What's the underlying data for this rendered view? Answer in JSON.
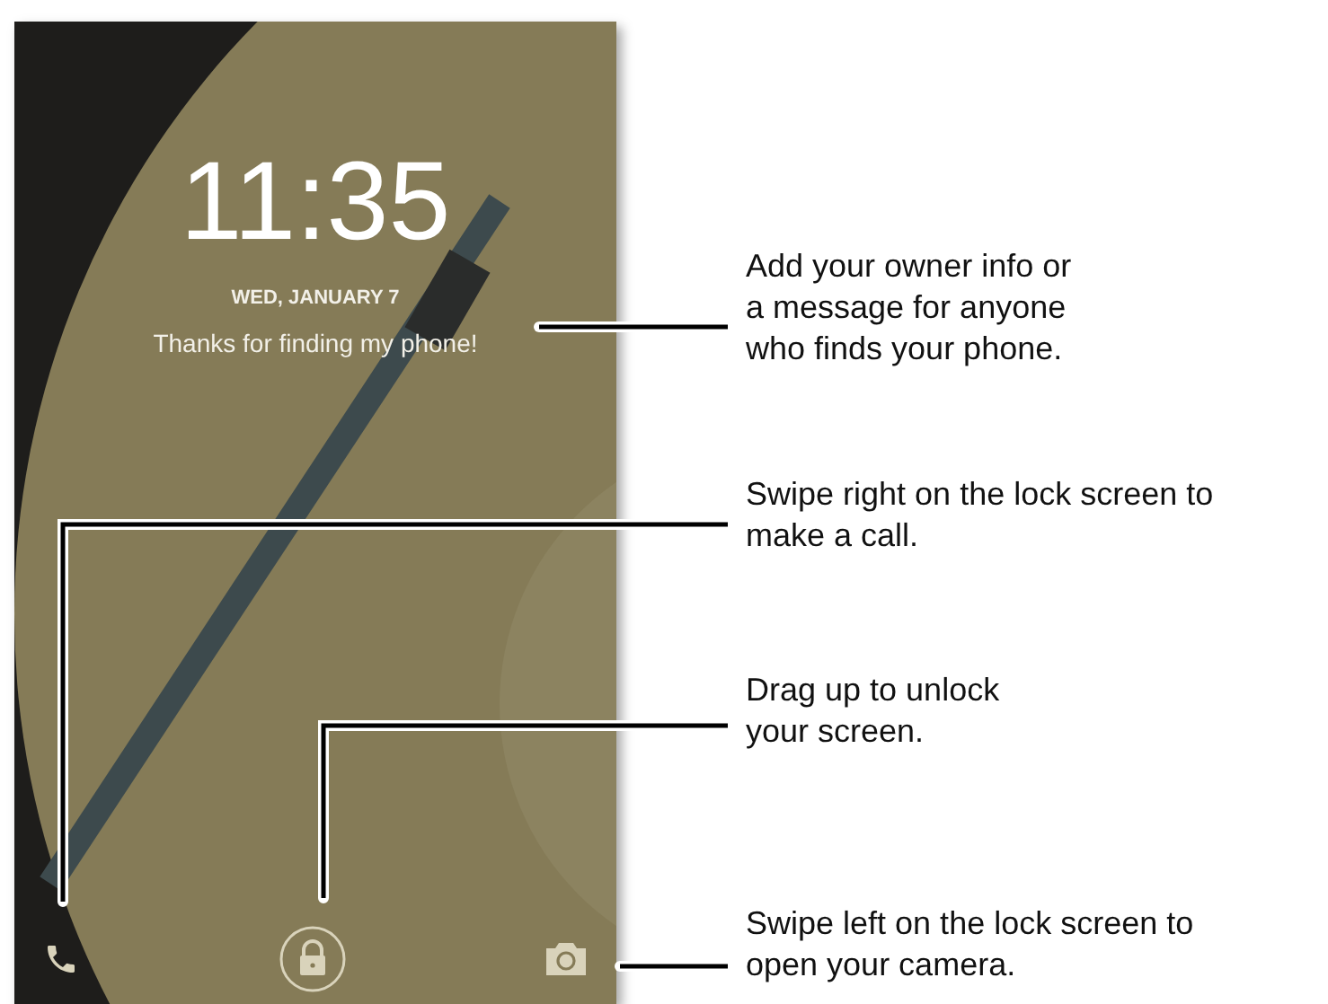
{
  "lock_screen": {
    "time": "11:35",
    "date": "WED, JANUARY 7",
    "owner_message": "Thanks for finding my phone!"
  },
  "callouts": [
    {
      "kind": "owner-info",
      "text": "Add your owner info or\na message for anyone\nwho finds your phone."
    },
    {
      "kind": "phone",
      "text": "Swipe right on the lock screen to\nmake a call."
    },
    {
      "kind": "unlock",
      "text": "Drag up to unlock\nyour screen."
    },
    {
      "kind": "camera",
      "text": "Swipe left on the lock screen to\nopen your camera."
    }
  ]
}
